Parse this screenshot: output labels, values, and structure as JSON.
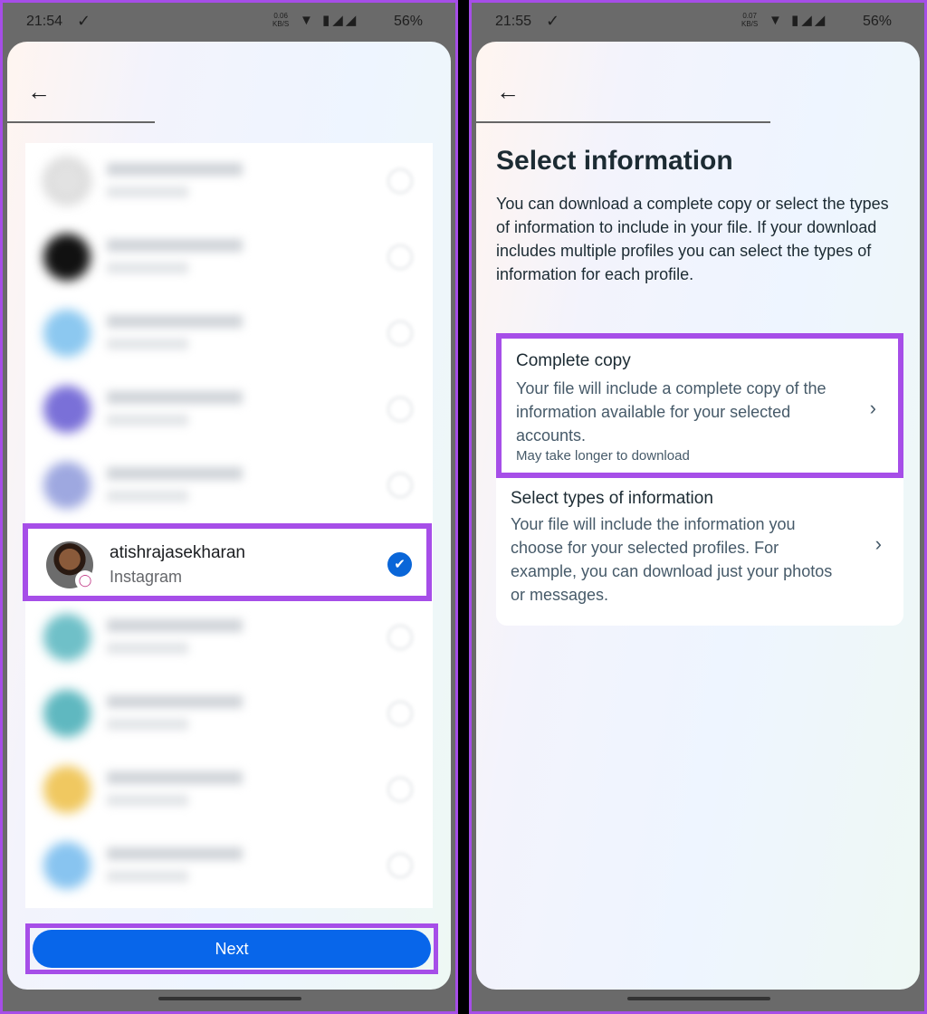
{
  "colors": {
    "highlight": "#a64ee8",
    "primary": "#0866ea"
  },
  "left": {
    "status": {
      "time": "21:54",
      "net_speed": "0.06",
      "net_unit": "KB/S",
      "battery": "56%"
    },
    "back_icon": "arrow-left",
    "selected_account": {
      "name": "atishrajasekharan",
      "source": "Instagram",
      "checked": true
    },
    "next_label": "Next"
  },
  "right": {
    "status": {
      "time": "21:55",
      "net_speed": "0.07",
      "net_unit": "KB/S",
      "battery": "56%"
    },
    "back_icon": "arrow-left",
    "title": "Select information",
    "description": "You can download a complete copy or select the types of information to include in your file. If your download includes multiple profiles you can select the types of information for each profile.",
    "options": [
      {
        "title": "Complete copy",
        "body": "Your file will include a complete copy of the information available for your selected accounts.",
        "note": "May take longer to download"
      },
      {
        "title": "Select types of information",
        "body": "Your file will include the information you choose for your selected profiles. For example, you can download just your photos or messages."
      }
    ]
  }
}
